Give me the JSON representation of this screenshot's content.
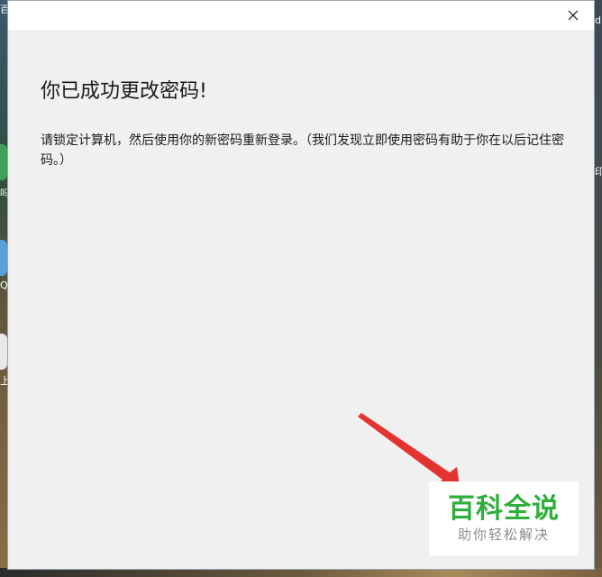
{
  "desktop": {
    "left_labels": [
      "百",
      "吗",
      "Q",
      "上"
    ],
    "right_labels": [
      "d",
      "印"
    ]
  },
  "dialog": {
    "close_glyph": "✕",
    "heading": "你已成功更改密码!",
    "message": "请锁定计算机，然后使用你的新密码重新登录。（我们发现立即使用密码有助于你在以后记住密码。）"
  },
  "watermark": {
    "title": "百科全说",
    "subtitle": "助你轻松解决",
    "color": "#2eaf3a"
  },
  "annotation": {
    "arrow_color": "#e3342f",
    "icon": "red-arrow"
  }
}
